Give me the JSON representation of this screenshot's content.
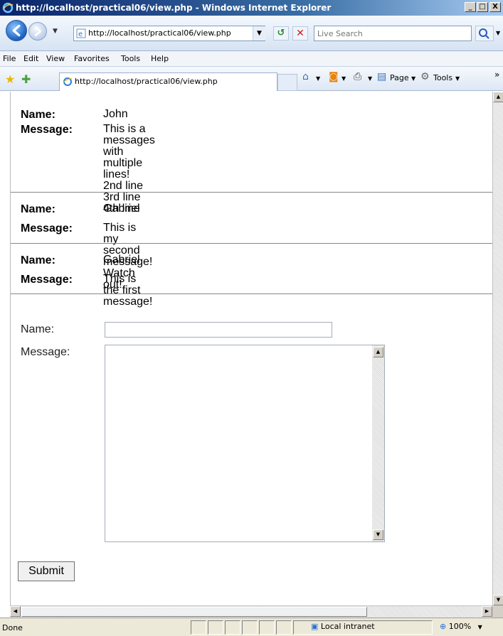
{
  "window": {
    "title": "http://localhost/practical06/view.php - Windows Internet Explorer",
    "min_label": "_",
    "max_label": "□",
    "close_label": "X"
  },
  "nav": {
    "address": "http://localhost/practical06/view.php",
    "search_placeholder": "Live Search"
  },
  "menu": {
    "items": [
      "File",
      "Edit",
      "View",
      "Favorites",
      "Tools",
      "Help"
    ]
  },
  "favbar": {
    "tab_label": "http://localhost/practical06/view.php",
    "page_label": "Page",
    "tools_label": "Tools"
  },
  "messages": [
    {
      "name_label": "Name:",
      "name": "John",
      "message_label": "Message:",
      "message": "This is a messages with multiple lines!\n2nd line\n3rd line\n4th line"
    },
    {
      "name_label": "Name:",
      "name": "Gabriel",
      "message_label": "Message:",
      "message": "This is my second message! Watch out!"
    },
    {
      "name_label": "Name:",
      "name": "Gabriel",
      "message_label": "Message:",
      "message": "This is the first message!"
    }
  ],
  "form": {
    "name_label": "Name:",
    "name_value": "",
    "message_label": "Message:",
    "message_value": "",
    "submit_label": "Submit"
  },
  "status": {
    "text": "Done",
    "zone": "Local intranet",
    "zoom": "100%"
  }
}
